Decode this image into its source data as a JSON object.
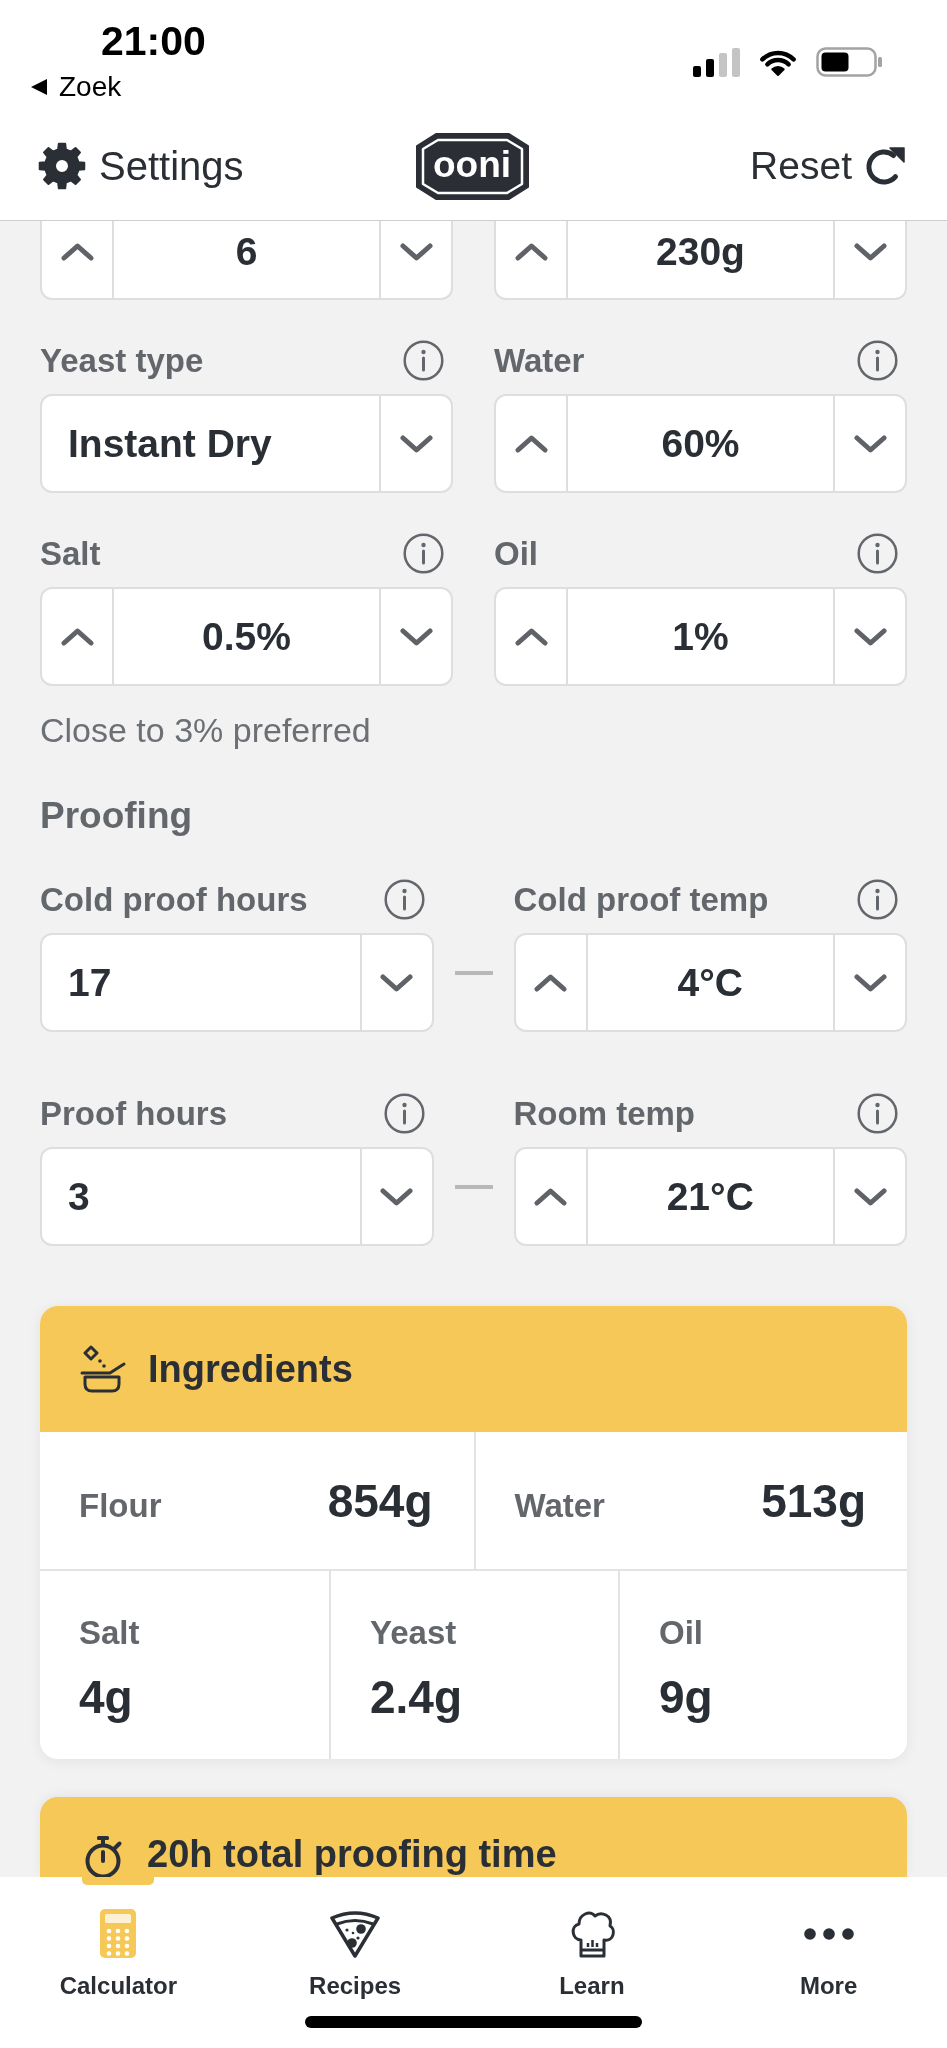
{
  "status_bar": {
    "time": "21:00",
    "back_label": "Zoek"
  },
  "header": {
    "settings_label": "Settings",
    "logo_text": "ooni",
    "reset_label": "Reset"
  },
  "top_steppers": [
    {
      "kind": "stepper",
      "value": "6"
    },
    {
      "kind": "stepper",
      "value": "230g"
    }
  ],
  "dough_fields": [
    {
      "label": "Yeast type",
      "kind": "select",
      "value": "Instant Dry"
    },
    {
      "label": "Water",
      "kind": "stepper",
      "value": "60%"
    },
    {
      "label": "Salt",
      "kind": "stepper",
      "value": "0.5%"
    },
    {
      "label": "Oil",
      "kind": "stepper",
      "value": "1%"
    }
  ],
  "salt_hint": "Close to 3% preferred",
  "proofing": {
    "title": "Proofing",
    "rows": [
      {
        "left": {
          "label": "Cold proof hours",
          "kind": "select",
          "value": "17"
        },
        "right": {
          "label": "Cold proof temp",
          "kind": "stepper",
          "value": "4°C"
        }
      },
      {
        "left": {
          "label": "Proof hours",
          "kind": "select",
          "value": "3"
        },
        "right": {
          "label": "Room temp",
          "kind": "stepper",
          "value": "21°C"
        }
      }
    ]
  },
  "ingredients": {
    "title": "Ingredients",
    "rows": [
      {
        "kind": "inline",
        "items": [
          {
            "name": "Flour",
            "amount": "854g"
          },
          {
            "name": "Water",
            "amount": "513g"
          }
        ]
      },
      {
        "kind": "stacked",
        "items": [
          {
            "name": "Salt",
            "amount": "4g"
          },
          {
            "name": "Yeast",
            "amount": "2.4g"
          },
          {
            "name": "Oil",
            "amount": "9g"
          }
        ]
      }
    ]
  },
  "proofing_time": {
    "title": "20h total proofing time"
  },
  "tab_bar": {
    "tabs": [
      {
        "label": "Calculator",
        "selected": true
      },
      {
        "label": "Recipes",
        "selected": false
      },
      {
        "label": "Learn",
        "selected": false
      },
      {
        "label": "More",
        "selected": false
      }
    ]
  }
}
